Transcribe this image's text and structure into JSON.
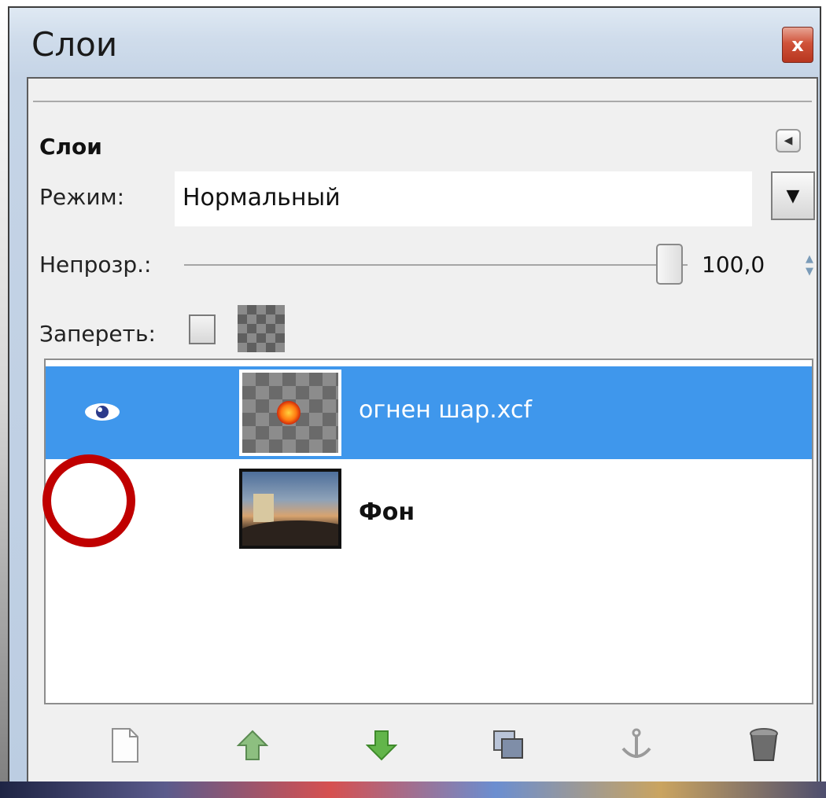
{
  "window": {
    "title": "Слои",
    "close_label": "x"
  },
  "panel": {
    "title": "Слои",
    "mode_label": "Режим:",
    "mode_value": "Нормальный",
    "opacity_label": "Непрозр.:",
    "opacity_value": "100,0",
    "lock_label": "Запереть:"
  },
  "layers": [
    {
      "name": "огнен шар.xcf",
      "visible": true,
      "selected": true
    },
    {
      "name": "Фон",
      "visible": false,
      "selected": false
    }
  ],
  "colors": {
    "selected_row": "#3f97ec",
    "highlight_circle": "#c00000"
  },
  "toolbar": [
    {
      "icon": "new-layer-icon"
    },
    {
      "icon": "raise-layer-icon"
    },
    {
      "icon": "lower-layer-icon"
    },
    {
      "icon": "duplicate-layer-icon"
    },
    {
      "icon": "anchor-layer-icon"
    },
    {
      "icon": "delete-layer-icon"
    }
  ]
}
